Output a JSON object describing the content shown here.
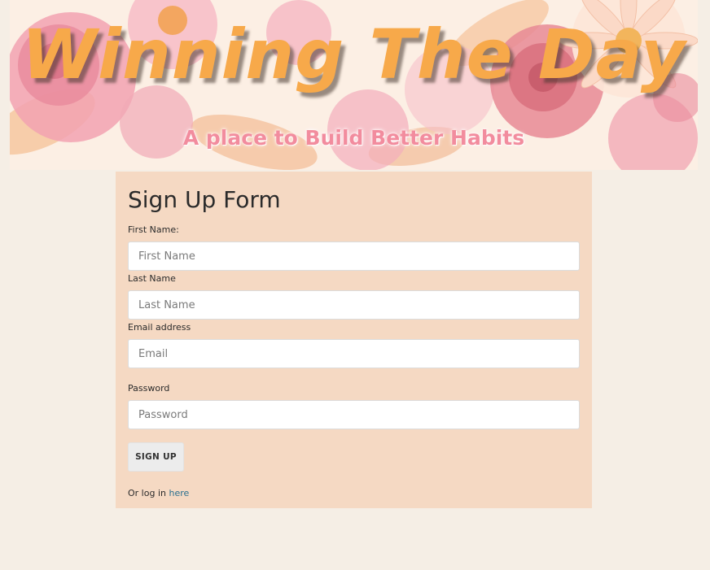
{
  "banner": {
    "title": "Winning The Day",
    "subtitle": "A place to Build Better Habits"
  },
  "form": {
    "heading": "Sign Up Form",
    "first_name": {
      "label": "First Name:",
      "placeholder": "First Name",
      "value": ""
    },
    "last_name": {
      "label": "Last Name",
      "placeholder": "Last Name",
      "value": ""
    },
    "email": {
      "label": "Email address",
      "placeholder": "Email",
      "value": ""
    },
    "password": {
      "label": "Password",
      "placeholder": "Password",
      "value": ""
    },
    "submit_label": "SIGN UP",
    "login_prefix": "Or log in",
    "login_link": "here"
  },
  "colors": {
    "page_background": "#f5eee5",
    "panel_background": "#f5d9c3",
    "banner_title": "#f7a94a",
    "banner_subtitle": "#f28c9e",
    "link": "#2a6f8f"
  }
}
